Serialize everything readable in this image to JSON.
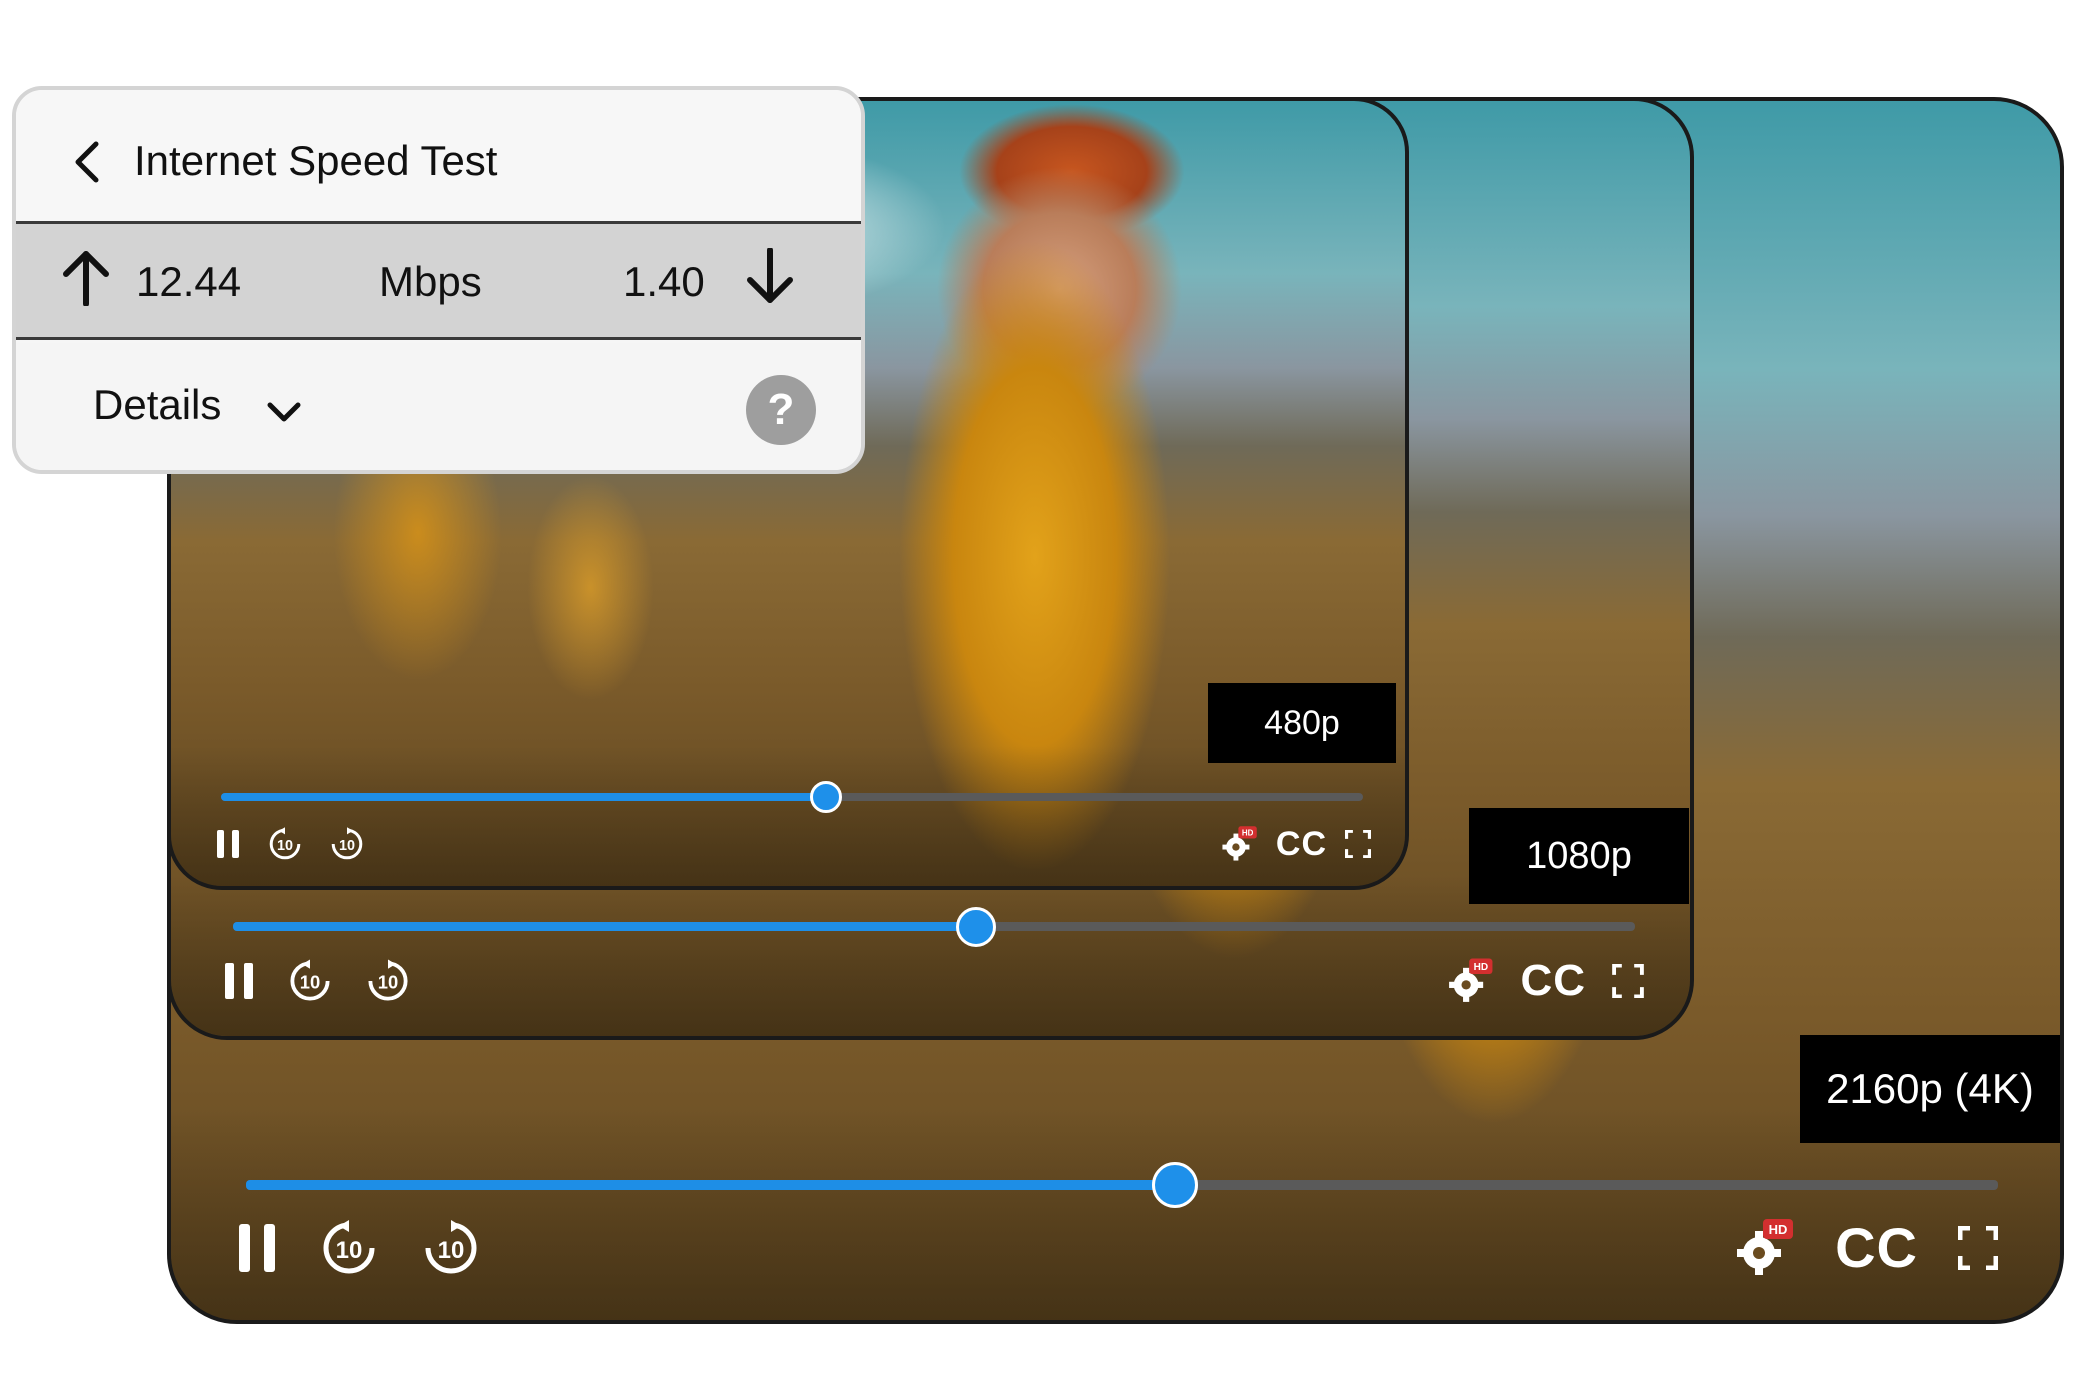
{
  "speed_test": {
    "title": "Internet Speed Test",
    "upload_value": "12.44",
    "unit": "Mbps",
    "download_value": "1.40",
    "details_label": "Details",
    "help_label": "?"
  },
  "players": [
    {
      "resolution": "480p",
      "progress": 0.53,
      "cc_label": "CC",
      "hd_label": "HD",
      "skip_seconds": "10"
    },
    {
      "resolution": "1080p",
      "progress": 0.53,
      "cc_label": "CC",
      "hd_label": "HD",
      "skip_seconds": "10"
    },
    {
      "resolution": "2160p (4K)",
      "progress": 0.53,
      "cc_label": "CC",
      "hd_label": "HD",
      "skip_seconds": "10"
    }
  ],
  "colors": {
    "accent": "#1e8ee6",
    "badge_bg": "#000000",
    "hd_badge": "#d32f2f"
  }
}
